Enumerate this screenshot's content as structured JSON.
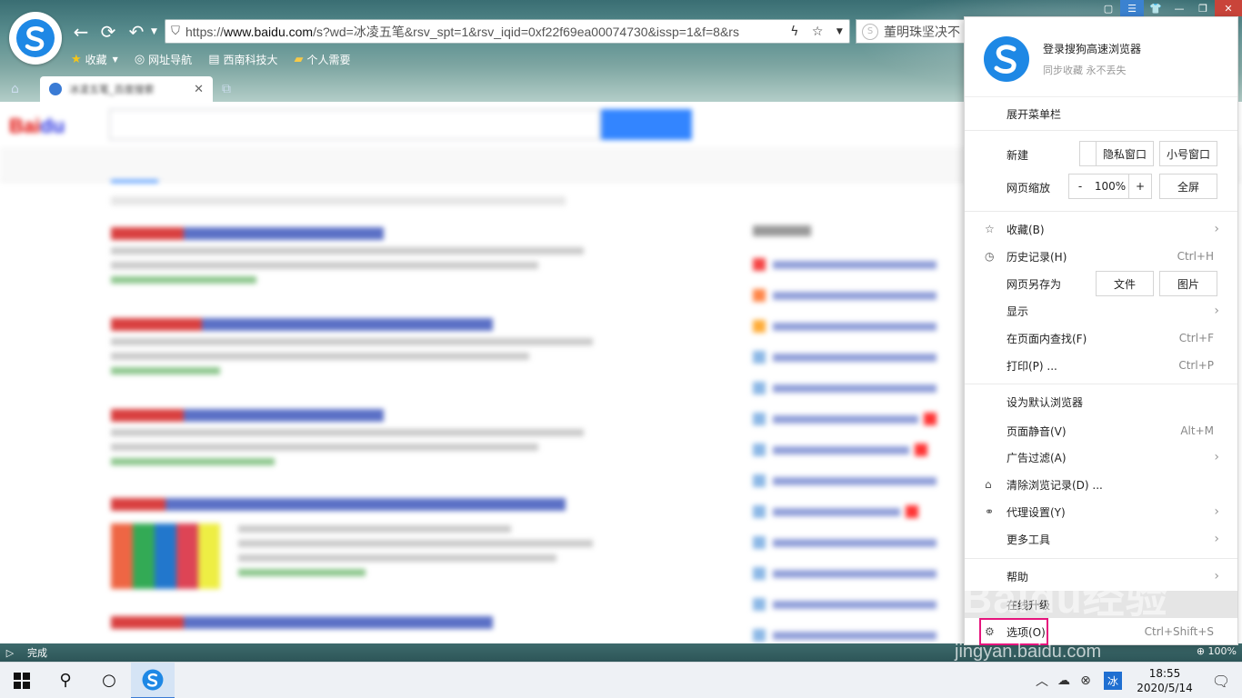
{
  "browser": {
    "address": {
      "scheme": "https://",
      "host": "www.baidu.com",
      "path": "/s?wd=冰凌五笔&rsv_spt=1&rsv_iqid=0xf22f69ea00074730&issp=1&f=8&rs"
    },
    "search_box_text": "董明珠坚决不",
    "bookmarks": [
      {
        "label": "收藏",
        "icon": "star-icon"
      },
      {
        "label": "网址导航",
        "icon": "globe-icon"
      },
      {
        "label": "西南科技大",
        "icon": "page-icon"
      },
      {
        "label": "个人需要",
        "icon": "folder-icon"
      }
    ],
    "tab_title": "冰凌五笔_百度搜索",
    "status_text": "完成",
    "zoom_status": "100%"
  },
  "menu": {
    "header_title": "登录搜狗高速浏览器",
    "header_subtitle": "同步收藏 永不丢失",
    "show_menubar": "展开菜单栏",
    "new_label": "新建",
    "new_window": "窗 口",
    "new_private": "隐私窗口",
    "new_small": "小号窗口",
    "zoom_label": "网页缩放",
    "zoom_minus": "-",
    "zoom_value": "100%",
    "zoom_plus": "+",
    "fullscreen": "全屏",
    "favorites": "收藏(B)",
    "history": "历史记录(H)",
    "history_shortcut": "Ctrl+H",
    "save_as": "网页另存为",
    "save_file": "文件",
    "save_image": "图片",
    "display": "显示",
    "find": "在页面内查找(F)",
    "find_shortcut": "Ctrl+F",
    "print": "打印(P) ...",
    "print_shortcut": "Ctrl+P",
    "set_default": "设为默认浏览器",
    "mute": "页面静音(V)",
    "mute_shortcut": "Alt+M",
    "adblock": "广告过滤(A)",
    "clear_history": "清除浏览记录(D) ...",
    "proxy": "代理设置(Y)",
    "more_tools": "更多工具",
    "help": "帮助",
    "online_upgrade": "在线升级",
    "options": "选项(O)",
    "options_shortcut": "Ctrl+Shift+S"
  },
  "watermark": {
    "line1": "Baidu经验",
    "line2": "jingyan.baidu.com"
  },
  "taskbar": {
    "time": "18:55",
    "date": "2020/5/14",
    "ime": "冰"
  }
}
